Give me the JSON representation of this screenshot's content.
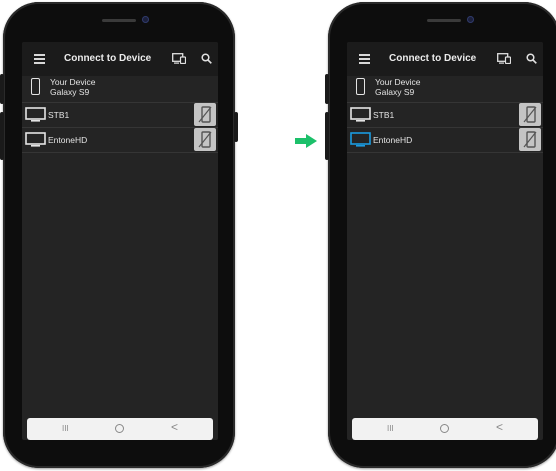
{
  "app": {
    "title": "Connect to Device"
  },
  "device": {
    "name": "Your Device",
    "model": "Galaxy S9"
  },
  "receivers": [
    {
      "name": "STB1"
    },
    {
      "name": "EntoneHD"
    }
  ],
  "navbar": {
    "recent": "III",
    "back": "<"
  },
  "colors": {
    "arrow": "#1cc06a",
    "selected_tv": "#1b9be0",
    "default_tv": "#e4e4e4"
  },
  "icons": {
    "menu": "hamburger-icon",
    "cast": "cast-icon",
    "search": "search-icon",
    "device": "smartphone-icon",
    "receiver": "tv-icon",
    "remote": "remote-phone-icon"
  }
}
